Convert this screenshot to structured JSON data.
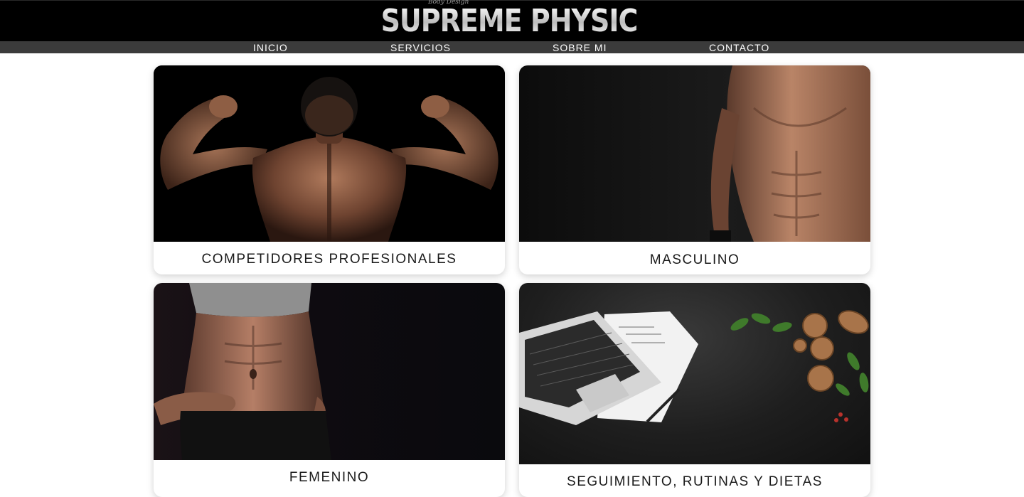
{
  "header": {
    "logo_text": "SUPREME PHYSIC",
    "logo_script": "Body Design"
  },
  "nav": {
    "items": [
      {
        "label": "INICIO"
      },
      {
        "label": "SERVICIOS"
      },
      {
        "label": "SOBRE MI"
      },
      {
        "label": "CONTACTO"
      }
    ]
  },
  "services": {
    "cards": [
      {
        "label": "COMPETIDORES PROFESIONALES",
        "image": "bodybuilder-back-photo"
      },
      {
        "label": "MASCULINO",
        "image": "male-torso-photo"
      },
      {
        "label": "FEMENINO",
        "image": "female-abs-photo"
      },
      {
        "label": "SEGUIMIENTO, RUTINAS Y DIETAS",
        "image": "laptop-nutrition-photo"
      }
    ]
  },
  "colors": {
    "header_bg": "#000000",
    "nav_bg": "#3b3b3b",
    "nav_text": "#ffffff",
    "card_bg": "#ffffff",
    "label_text": "#1a1a1a"
  }
}
